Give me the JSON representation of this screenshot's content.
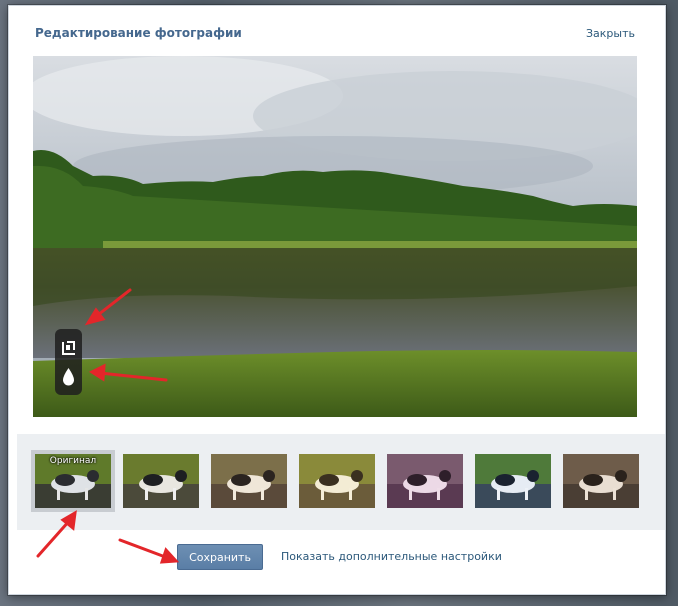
{
  "dialog": {
    "title": "Редактирование фотографии",
    "close_label": "Закрыть"
  },
  "photo_tools": [
    {
      "name": "crop-icon"
    },
    {
      "name": "drop-icon"
    }
  ],
  "filters": [
    {
      "label": "Оригинал",
      "selected": true
    },
    {
      "label": "",
      "selected": false
    },
    {
      "label": "",
      "selected": false
    },
    {
      "label": "",
      "selected": false
    },
    {
      "label": "",
      "selected": false
    },
    {
      "label": "",
      "selected": false
    },
    {
      "label": "",
      "selected": false
    }
  ],
  "actions": {
    "save_label": "Сохранить",
    "more_settings_label": "Показать дополнительные настройки"
  },
  "colors": {
    "accent": "#45688e",
    "link": "#2b587a",
    "button": "#5a7ea6",
    "annotation_arrow": "#e3262a"
  }
}
